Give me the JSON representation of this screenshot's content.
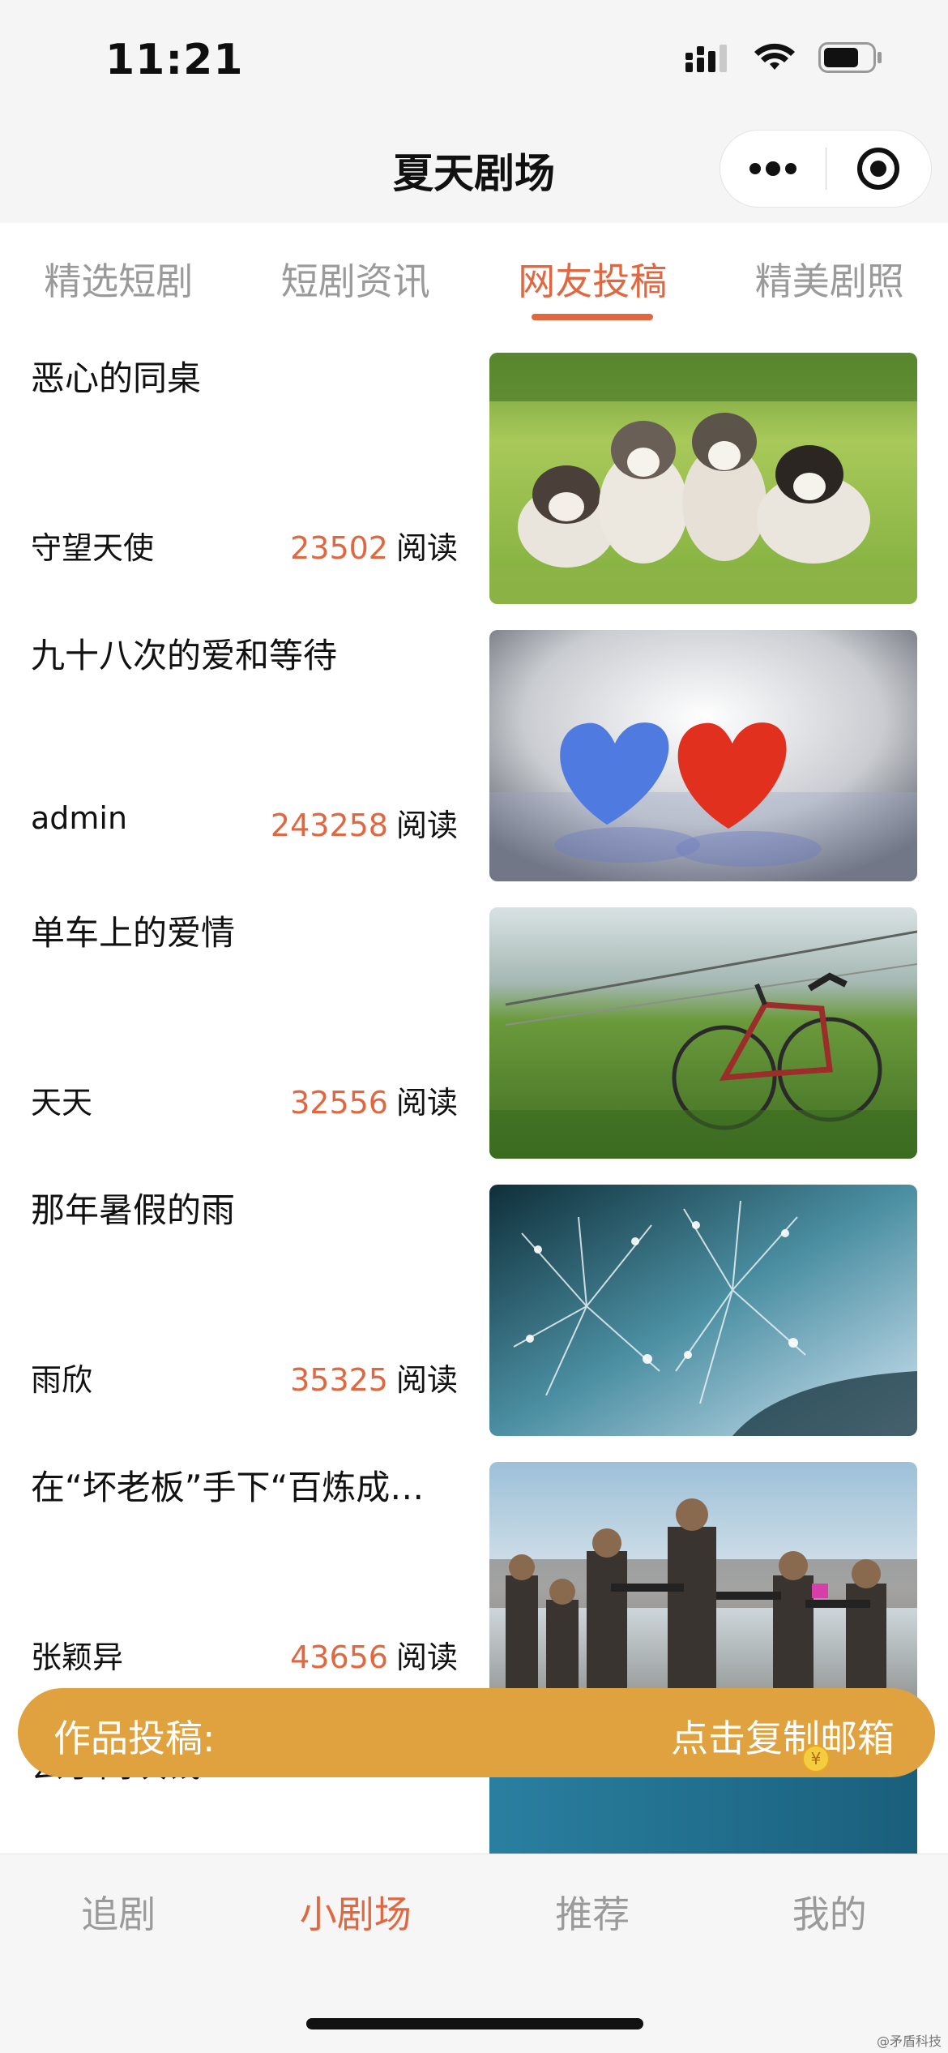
{
  "status_bar": {
    "time": "11:21",
    "icons": [
      "signal-icon",
      "wifi-icon",
      "battery-icon"
    ]
  },
  "nav": {
    "title": "夏天剧场",
    "capsule_icons": [
      "more-icon",
      "close-target-icon"
    ]
  },
  "tabs": [
    {
      "label": "精选短剧",
      "active": false
    },
    {
      "label": "短剧资讯",
      "active": false
    },
    {
      "label": "网友投稿",
      "active": true
    },
    {
      "label": "精美剧照",
      "active": false
    }
  ],
  "articles": [
    {
      "title": "恶心的同桌",
      "author": "守望天使",
      "reads": "23502",
      "read_label": "阅读",
      "thumb": "husky-puppies-image"
    },
    {
      "title": "九十八次的爱和等待",
      "author": "admin",
      "reads": "243258",
      "read_label": "阅读",
      "thumb": "hearts-on-snow-image"
    },
    {
      "title": "单车上的爱情",
      "author": "天天",
      "reads": "32556",
      "read_label": "阅读",
      "thumb": "bicycle-in-grass-image"
    },
    {
      "title": "那年暑假的雨",
      "author": "雨欣",
      "reads": "35325",
      "read_label": "阅读",
      "thumb": "dandelion-dew-image"
    },
    {
      "title": "在“坏老板”手下“百炼成…",
      "author": "张颖异",
      "reads": "43656",
      "read_label": "阅读",
      "thumb": "soldiers-game-image"
    },
    {
      "title": "去了网块钱",
      "author": "",
      "reads": "",
      "read_label": "",
      "thumb": "blue-abstract-image"
    }
  ],
  "banner": {
    "label": "作品投稿:",
    "action": "点击复制邮箱",
    "coin_symbol": "¥"
  },
  "tabbar": [
    {
      "label": "追剧",
      "active": false
    },
    {
      "label": "小剧场",
      "active": true
    },
    {
      "label": "推荐",
      "active": false
    },
    {
      "label": "我的",
      "active": false
    }
  ],
  "watermark": "@矛盾科技",
  "colors": {
    "accent": "#e0673f",
    "banner": "#e0a23e",
    "inactive": "#9a9a9a"
  }
}
